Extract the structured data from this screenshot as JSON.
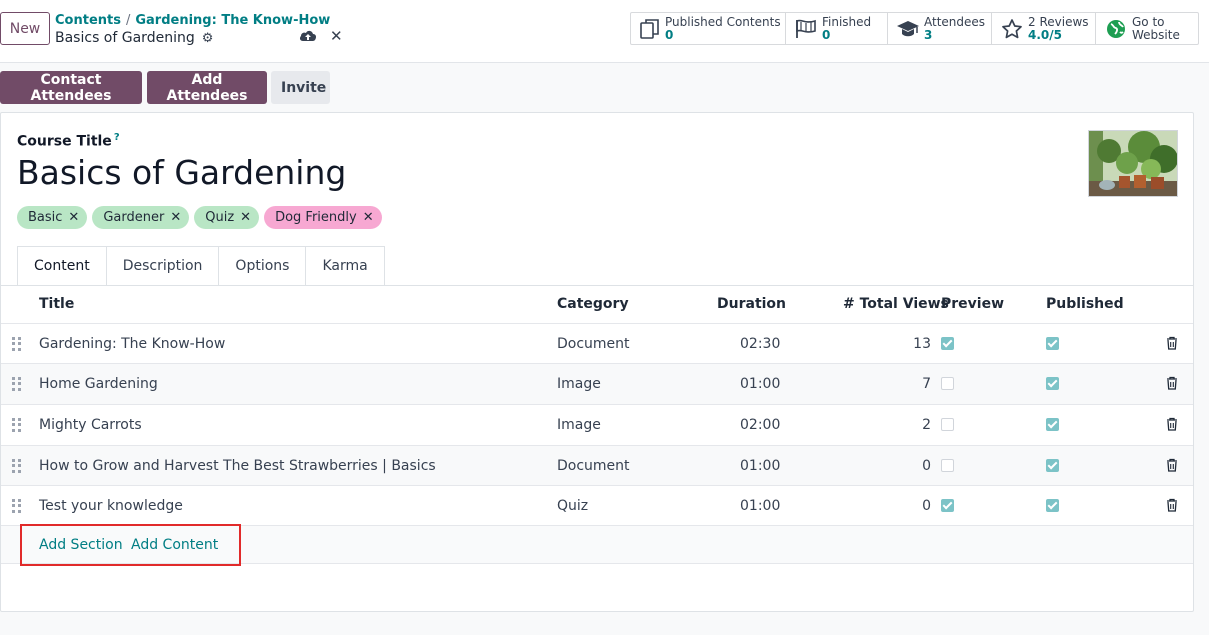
{
  "topbar": {
    "new_label": "New",
    "breadcrumb": [
      "Contents",
      "Gardening: The Know-How"
    ],
    "record_title": "Basics of Gardening",
    "stats": [
      {
        "label": "Published Contents",
        "value": "0",
        "icon": "documents-icon"
      },
      {
        "label": "Finished",
        "value": "0",
        "icon": "flag-icon"
      },
      {
        "label": "Attendees",
        "value": "3",
        "icon": "graduation-cap-icon"
      },
      {
        "label": "2 Reviews",
        "value": "4.0/5",
        "icon": "star-icon"
      },
      {
        "label": "Go to",
        "value": "Website",
        "icon": "globe-icon"
      }
    ]
  },
  "actions": {
    "contact": "Contact Attendees",
    "add": "Add Attendees",
    "invite": "Invite"
  },
  "form": {
    "title_label": "Course Title",
    "help_mark": "?",
    "course_title": "Basics of Gardening",
    "tags": [
      {
        "label": "Basic",
        "color": "#b9e6c5"
      },
      {
        "label": "Gardener",
        "color": "#b9e6c5"
      },
      {
        "label": "Quiz",
        "color": "#b9e6c5"
      },
      {
        "label": "Dog Friendly",
        "color": "#f7a8d2"
      }
    ],
    "tabs": [
      "Content",
      "Description",
      "Options",
      "Karma"
    ],
    "active_tab": "Content"
  },
  "list": {
    "headers": {
      "title": "Title",
      "category": "Category",
      "duration": "Duration",
      "views": "# Total Views",
      "preview": "Preview",
      "published": "Published"
    },
    "rows": [
      {
        "title": "Gardening: The Know-How",
        "category": "Document",
        "duration": "02:30",
        "views": "13",
        "preview": true,
        "published": true
      },
      {
        "title": "Home Gardening",
        "category": "Image",
        "duration": "01:00",
        "views": "7",
        "preview": false,
        "published": true
      },
      {
        "title": "Mighty Carrots",
        "category": "Image",
        "duration": "02:00",
        "views": "2",
        "preview": false,
        "published": true
      },
      {
        "title": "How to Grow and Harvest The Best Strawberries | Basics",
        "category": "Document",
        "duration": "01:00",
        "views": "0",
        "preview": false,
        "published": true
      },
      {
        "title": "Test your knowledge",
        "category": "Quiz",
        "duration": "01:00",
        "views": "0",
        "preview": true,
        "published": true
      }
    ],
    "add_section": "Add Section",
    "add_content": "Add Content"
  },
  "colors": {
    "primary": "#714b67",
    "link": "#017e84",
    "highlight": "#e12a2a"
  }
}
